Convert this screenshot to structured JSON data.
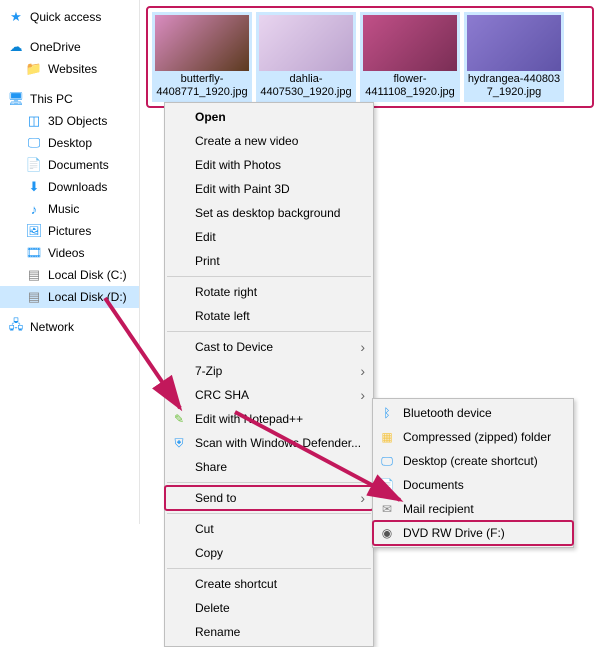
{
  "sidebar": {
    "quick_access": "Quick access",
    "onedrive": "OneDrive",
    "websites": "Websites",
    "this_pc": "This PC",
    "objects3d": "3D Objects",
    "desktop": "Desktop",
    "documents": "Documents",
    "downloads": "Downloads",
    "music": "Music",
    "pictures": "Pictures",
    "videos": "Videos",
    "local_c": "Local Disk (C:)",
    "local_d": "Local Disk (D:)",
    "network": "Network"
  },
  "thumbs": [
    {
      "caption": "butterfly-4408771_1920.jpg"
    },
    {
      "caption": "dahlia-4407530_1920.jpg"
    },
    {
      "caption": "flower-4411108_1920.jpg"
    },
    {
      "caption": "hydrangea-440803 7_1920.jpg"
    }
  ],
  "menu": {
    "open": "Open",
    "create_video": "Create a new video",
    "edit_photos": "Edit with Photos",
    "edit_paint3d": "Edit with Paint 3D",
    "set_wallpaper": "Set as desktop background",
    "edit": "Edit",
    "print": "Print",
    "rotate_right": "Rotate right",
    "rotate_left": "Rotate left",
    "cast": "Cast to Device",
    "sevenzip": "7-Zip",
    "crc_sha": "CRC SHA",
    "edit_npp": "Edit with Notepad++",
    "scan_defender": "Scan with Windows Defender...",
    "share": "Share",
    "send_to": "Send to",
    "cut": "Cut",
    "copy": "Copy",
    "create_shortcut": "Create shortcut",
    "delete": "Delete",
    "rename": "Rename"
  },
  "submenu": {
    "bluetooth": "Bluetooth device",
    "compressed": "Compressed (zipped) folder",
    "desktop_shortcut": "Desktop (create shortcut)",
    "documents": "Documents",
    "mail": "Mail recipient",
    "dvd": "DVD RW Drive (F:)"
  }
}
